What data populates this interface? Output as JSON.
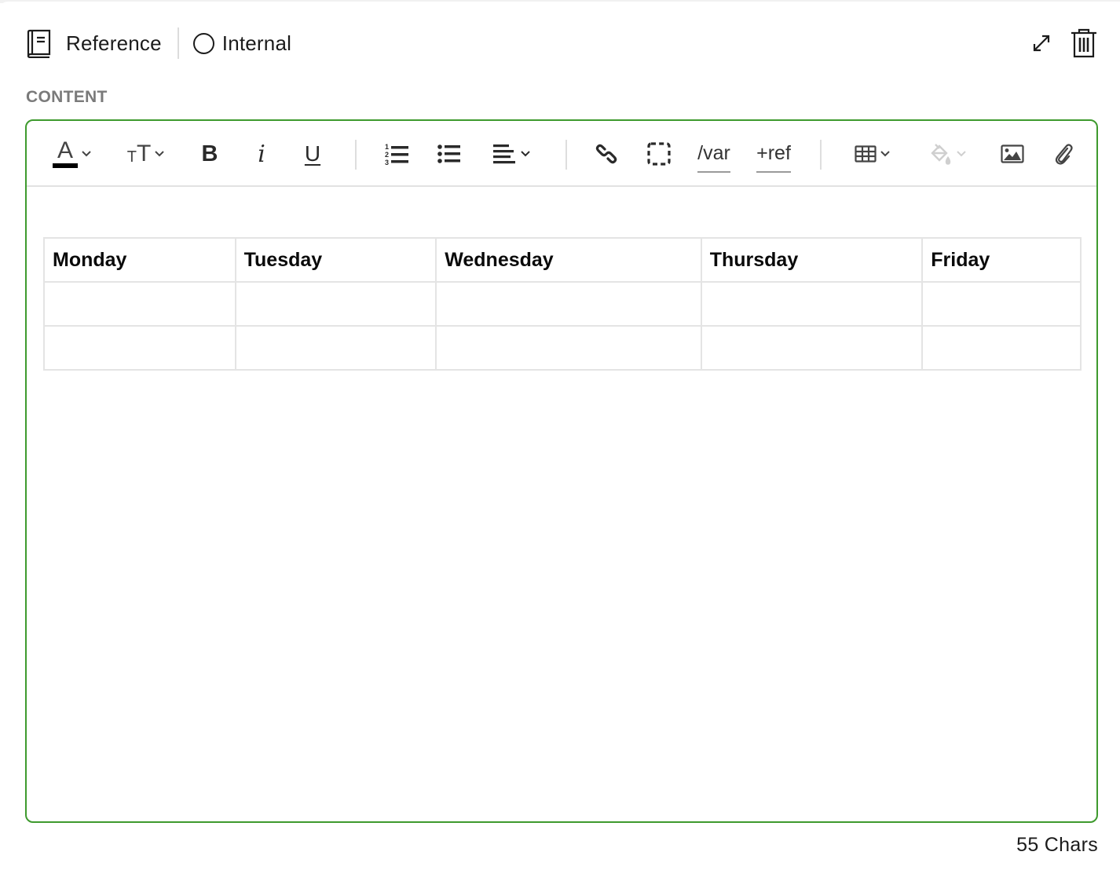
{
  "header": {
    "type_label": "Reference",
    "type_icon": "book-icon",
    "visibility_label": "Internal",
    "visibility_checked": false
  },
  "section": {
    "label": "CONTENT"
  },
  "toolbar": {
    "items": [
      {
        "name": "text-color",
        "icon": "text-color-icon"
      },
      {
        "name": "font-size",
        "icon": "font-size-icon"
      },
      {
        "name": "bold",
        "icon": "bold-icon",
        "label": "B"
      },
      {
        "name": "italic",
        "icon": "italic-icon",
        "label": "i"
      },
      {
        "name": "underline",
        "icon": "underline-icon",
        "label": "U"
      },
      {
        "name": "ordered-list",
        "icon": "ordered-list-icon"
      },
      {
        "name": "bullet-list",
        "icon": "bullet-list-icon"
      },
      {
        "name": "align",
        "icon": "align-left-icon"
      },
      {
        "name": "link",
        "icon": "link-icon"
      },
      {
        "name": "placeholder",
        "icon": "dashed-box-icon"
      },
      {
        "name": "variable",
        "label": "/var"
      },
      {
        "name": "reference",
        "label": "+ref"
      },
      {
        "name": "table",
        "icon": "table-icon"
      },
      {
        "name": "fill-color",
        "icon": "paint-bucket-icon",
        "disabled": true
      },
      {
        "name": "image",
        "icon": "image-icon"
      },
      {
        "name": "attachment",
        "icon": "paperclip-icon"
      }
    ],
    "text_color_value": "#000000",
    "text_color_letter": "A",
    "font_size_glyph_small": "T",
    "font_size_glyph_large": "T"
  },
  "table": {
    "headers": [
      "Monday",
      "Tuesday",
      "Wednesday",
      "Thursday",
      "Friday"
    ],
    "rows": [
      [
        "",
        "",
        "",
        "",
        ""
      ],
      [
        "",
        "",
        "",
        "",
        ""
      ]
    ]
  },
  "footer": {
    "char_count": "55 Chars"
  },
  "colors": {
    "accent_border": "#3e9a2e",
    "section_label": "#7a7a7a",
    "disabled_icon": "#c8c8c8"
  }
}
